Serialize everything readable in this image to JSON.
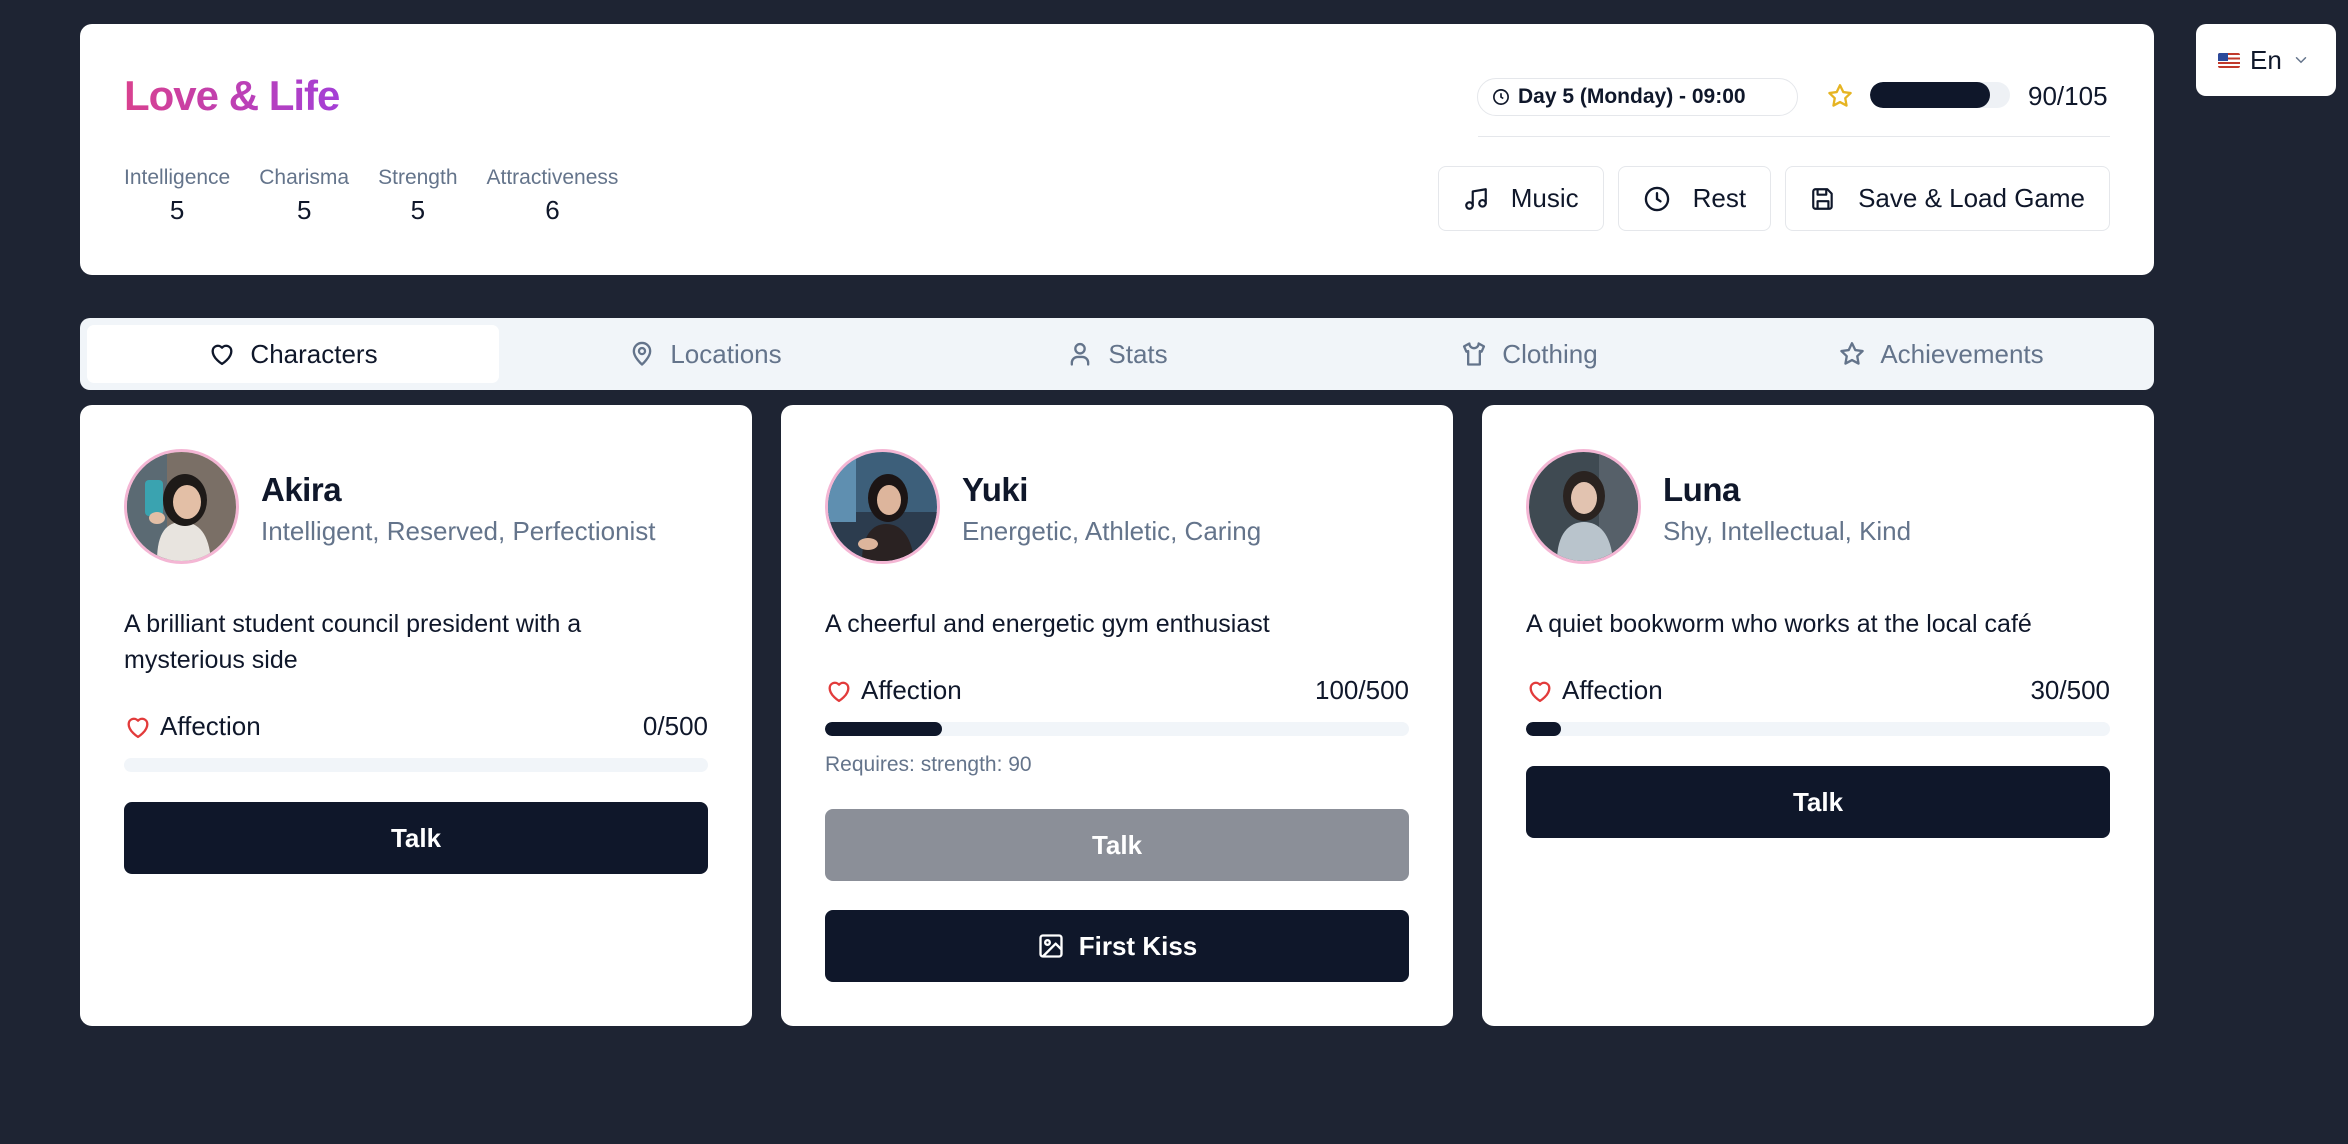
{
  "app": {
    "title": "Love & Life"
  },
  "header": {
    "day": "Day 5 (Monday) - 09:00",
    "level": {
      "text": "90/105",
      "progress": 0.857
    },
    "stats": [
      {
        "label": "Intelligence",
        "value": "5"
      },
      {
        "label": "Charisma",
        "value": "5"
      },
      {
        "label": "Strength",
        "value": "5"
      },
      {
        "label": "Attractiveness",
        "value": "6"
      }
    ],
    "actions": {
      "music": "Music",
      "rest": "Rest",
      "save": "Save & Load Game"
    }
  },
  "language": {
    "label": "En"
  },
  "tabs": [
    {
      "label": "Characters",
      "active": true
    },
    {
      "label": "Locations"
    },
    {
      "label": "Stats"
    },
    {
      "label": "Clothing"
    },
    {
      "label": "Achievements"
    }
  ],
  "characters": [
    {
      "name": "Akira",
      "traits": "Intelligent, Reserved, Perfectionist",
      "description": "A brilliant student council president with a mysterious side",
      "affection_label": "Affection",
      "affection": "0/500",
      "affection_progress": 0,
      "talk": "Talk"
    },
    {
      "name": "Yuki",
      "traits": "Energetic, Athletic, Caring",
      "description": "A cheerful and energetic gym enthusiast",
      "affection_label": "Affection",
      "affection": "100/500",
      "affection_progress": 0.2,
      "requires": "Requires: strength: 90",
      "talk": "Talk",
      "extra_action": "First Kiss"
    },
    {
      "name": "Luna",
      "traits": "Shy, Intellectual, Kind",
      "description": "A quiet bookworm who works at the local café",
      "affection_label": "Affection",
      "affection": "30/500",
      "affection_progress": 0.06,
      "talk": "Talk"
    }
  ],
  "colors": {
    "background": "#1e2433",
    "dark": "#0f172a",
    "heart": "#e23b3b",
    "star": "#e6b422"
  }
}
